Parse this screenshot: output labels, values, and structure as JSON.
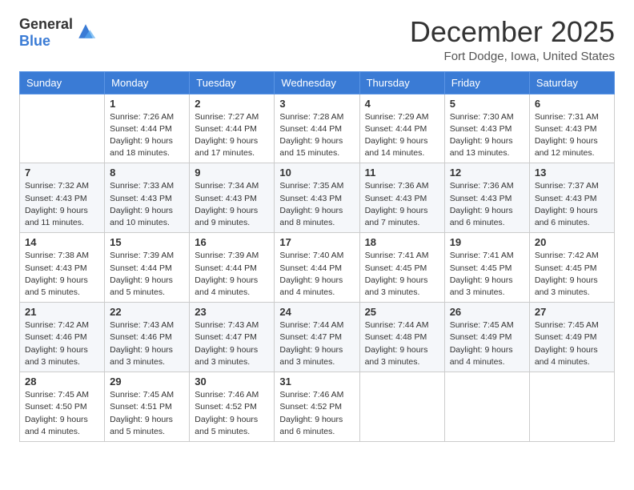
{
  "logo": {
    "general": "General",
    "blue": "Blue"
  },
  "header": {
    "month": "December 2025",
    "location": "Fort Dodge, Iowa, United States"
  },
  "weekdays": [
    "Sunday",
    "Monday",
    "Tuesday",
    "Wednesday",
    "Thursday",
    "Friday",
    "Saturday"
  ],
  "weeks": [
    [
      {
        "day": "",
        "info": ""
      },
      {
        "day": "1",
        "info": "Sunrise: 7:26 AM\nSunset: 4:44 PM\nDaylight: 9 hours\nand 18 minutes."
      },
      {
        "day": "2",
        "info": "Sunrise: 7:27 AM\nSunset: 4:44 PM\nDaylight: 9 hours\nand 17 minutes."
      },
      {
        "day": "3",
        "info": "Sunrise: 7:28 AM\nSunset: 4:44 PM\nDaylight: 9 hours\nand 15 minutes."
      },
      {
        "day": "4",
        "info": "Sunrise: 7:29 AM\nSunset: 4:44 PM\nDaylight: 9 hours\nand 14 minutes."
      },
      {
        "day": "5",
        "info": "Sunrise: 7:30 AM\nSunset: 4:43 PM\nDaylight: 9 hours\nand 13 minutes."
      },
      {
        "day": "6",
        "info": "Sunrise: 7:31 AM\nSunset: 4:43 PM\nDaylight: 9 hours\nand 12 minutes."
      }
    ],
    [
      {
        "day": "7",
        "info": "Sunrise: 7:32 AM\nSunset: 4:43 PM\nDaylight: 9 hours\nand 11 minutes."
      },
      {
        "day": "8",
        "info": "Sunrise: 7:33 AM\nSunset: 4:43 PM\nDaylight: 9 hours\nand 10 minutes."
      },
      {
        "day": "9",
        "info": "Sunrise: 7:34 AM\nSunset: 4:43 PM\nDaylight: 9 hours\nand 9 minutes."
      },
      {
        "day": "10",
        "info": "Sunrise: 7:35 AM\nSunset: 4:43 PM\nDaylight: 9 hours\nand 8 minutes."
      },
      {
        "day": "11",
        "info": "Sunrise: 7:36 AM\nSunset: 4:43 PM\nDaylight: 9 hours\nand 7 minutes."
      },
      {
        "day": "12",
        "info": "Sunrise: 7:36 AM\nSunset: 4:43 PM\nDaylight: 9 hours\nand 6 minutes."
      },
      {
        "day": "13",
        "info": "Sunrise: 7:37 AM\nSunset: 4:43 PM\nDaylight: 9 hours\nand 6 minutes."
      }
    ],
    [
      {
        "day": "14",
        "info": "Sunrise: 7:38 AM\nSunset: 4:43 PM\nDaylight: 9 hours\nand 5 minutes."
      },
      {
        "day": "15",
        "info": "Sunrise: 7:39 AM\nSunset: 4:44 PM\nDaylight: 9 hours\nand 5 minutes."
      },
      {
        "day": "16",
        "info": "Sunrise: 7:39 AM\nSunset: 4:44 PM\nDaylight: 9 hours\nand 4 minutes."
      },
      {
        "day": "17",
        "info": "Sunrise: 7:40 AM\nSunset: 4:44 PM\nDaylight: 9 hours\nand 4 minutes."
      },
      {
        "day": "18",
        "info": "Sunrise: 7:41 AM\nSunset: 4:45 PM\nDaylight: 9 hours\nand 3 minutes."
      },
      {
        "day": "19",
        "info": "Sunrise: 7:41 AM\nSunset: 4:45 PM\nDaylight: 9 hours\nand 3 minutes."
      },
      {
        "day": "20",
        "info": "Sunrise: 7:42 AM\nSunset: 4:45 PM\nDaylight: 9 hours\nand 3 minutes."
      }
    ],
    [
      {
        "day": "21",
        "info": "Sunrise: 7:42 AM\nSunset: 4:46 PM\nDaylight: 9 hours\nand 3 minutes."
      },
      {
        "day": "22",
        "info": "Sunrise: 7:43 AM\nSunset: 4:46 PM\nDaylight: 9 hours\nand 3 minutes."
      },
      {
        "day": "23",
        "info": "Sunrise: 7:43 AM\nSunset: 4:47 PM\nDaylight: 9 hours\nand 3 minutes."
      },
      {
        "day": "24",
        "info": "Sunrise: 7:44 AM\nSunset: 4:47 PM\nDaylight: 9 hours\nand 3 minutes."
      },
      {
        "day": "25",
        "info": "Sunrise: 7:44 AM\nSunset: 4:48 PM\nDaylight: 9 hours\nand 3 minutes."
      },
      {
        "day": "26",
        "info": "Sunrise: 7:45 AM\nSunset: 4:49 PM\nDaylight: 9 hours\nand 4 minutes."
      },
      {
        "day": "27",
        "info": "Sunrise: 7:45 AM\nSunset: 4:49 PM\nDaylight: 9 hours\nand 4 minutes."
      }
    ],
    [
      {
        "day": "28",
        "info": "Sunrise: 7:45 AM\nSunset: 4:50 PM\nDaylight: 9 hours\nand 4 minutes."
      },
      {
        "day": "29",
        "info": "Sunrise: 7:45 AM\nSunset: 4:51 PM\nDaylight: 9 hours\nand 5 minutes."
      },
      {
        "day": "30",
        "info": "Sunrise: 7:46 AM\nSunset: 4:52 PM\nDaylight: 9 hours\nand 5 minutes."
      },
      {
        "day": "31",
        "info": "Sunrise: 7:46 AM\nSunset: 4:52 PM\nDaylight: 9 hours\nand 6 minutes."
      },
      {
        "day": "",
        "info": ""
      },
      {
        "day": "",
        "info": ""
      },
      {
        "day": "",
        "info": ""
      }
    ]
  ]
}
